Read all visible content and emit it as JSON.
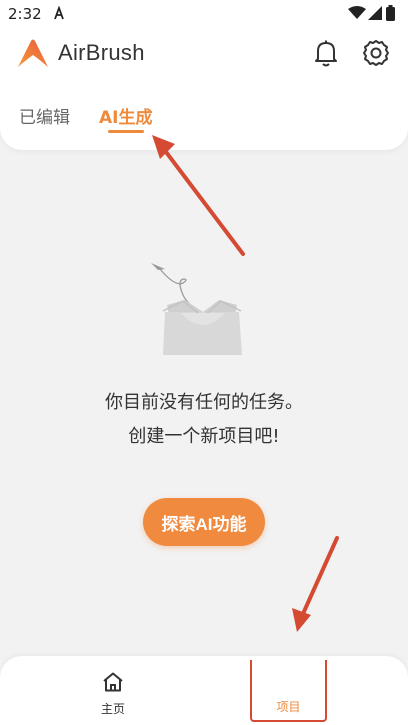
{
  "status_bar": {
    "time": "2:32"
  },
  "header": {
    "app_title": "AirBrush"
  },
  "tabs": [
    {
      "label": "已编辑",
      "active": false
    },
    {
      "label": "AI生成",
      "active": true
    }
  ],
  "empty_state": {
    "line1": "你目前没有任何的任务。",
    "line2": "创建一个新项目吧!",
    "button_label": "探索AI功能"
  },
  "bottom_nav": {
    "home_label": "主页",
    "project_label": "项目"
  },
  "colors": {
    "accent": "#ee8a3c",
    "annotation": "#d44a33"
  },
  "icons": [
    "airbrush-logo-icon",
    "bell-icon",
    "gear-icon",
    "empty-box-icon",
    "home-icon"
  ]
}
